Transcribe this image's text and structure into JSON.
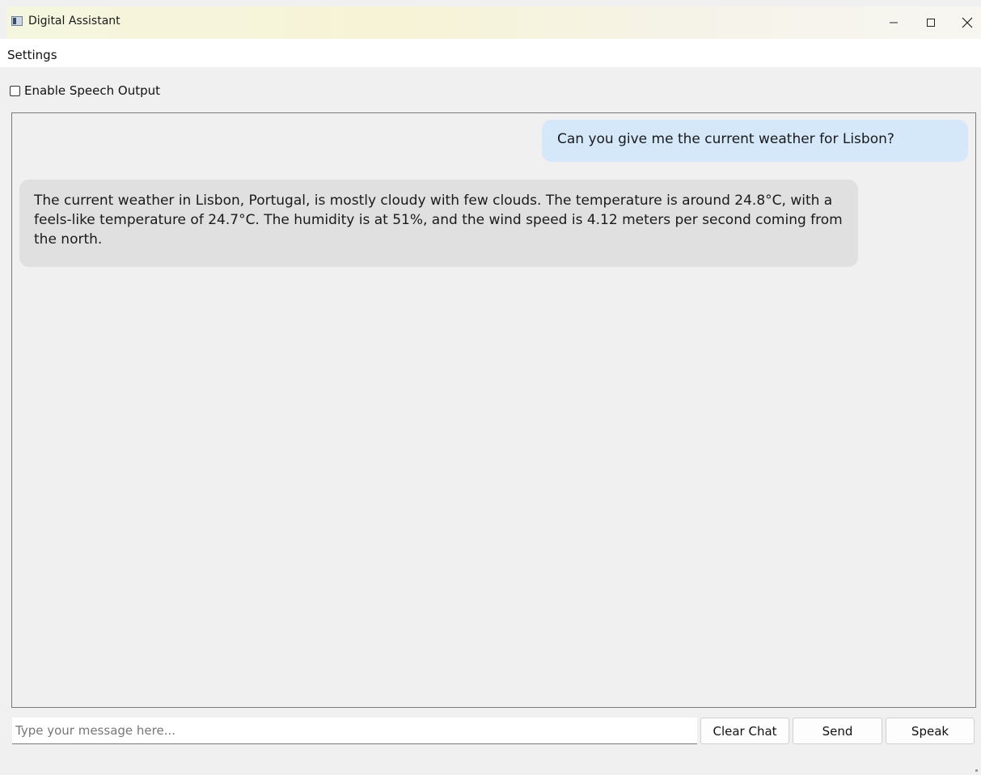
{
  "window": {
    "title": "Digital Assistant",
    "icon": "app-window-icon"
  },
  "menu": {
    "settings_label": "Settings"
  },
  "options": {
    "speech_output_label": "Enable Speech Output",
    "speech_output_checked": false
  },
  "chat": {
    "messages": [
      {
        "role": "user",
        "text": "Can you give me the current weather for Lisbon?"
      },
      {
        "role": "assistant",
        "text": "The current weather in Lisbon, Portugal, is mostly cloudy with few clouds. The temperature is around 24.8°C, with a feels-like temperature of 24.7°C. The humidity is at 51%, and the wind speed is 4.12 meters per second coming from the north."
      }
    ]
  },
  "composer": {
    "placeholder": "Type your message here...",
    "value": ""
  },
  "buttons": {
    "clear_label": "Clear Chat",
    "send_label": "Send",
    "speak_label": "Speak"
  },
  "colors": {
    "user_bubble": "#d4e8f9",
    "assistant_bubble": "#e0e0e0",
    "window_background": "#f0f0f0"
  }
}
